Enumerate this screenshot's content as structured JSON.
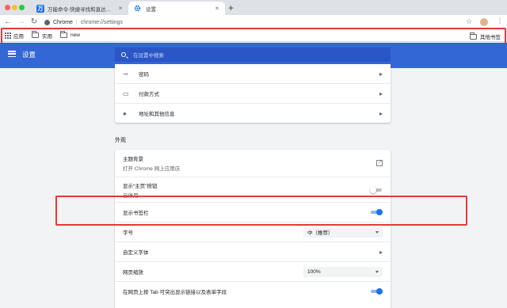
{
  "browser": {
    "tabs": [
      {
        "favicon_text": "万",
        "title": "万能命令-快捷寻找和直达你想要的...",
        "close": "×"
      },
      {
        "title": "设置",
        "close": "×"
      }
    ],
    "new_tab": "+",
    "omnibox": {
      "scheme_label": "Chrome",
      "separator": "|",
      "url": "chrome://settings"
    },
    "bookmarks": [
      {
        "label": "应用",
        "icon": "apps-grid-icon"
      },
      {
        "label": "实用",
        "icon": "folder-icon"
      },
      {
        "label": "new",
        "icon": "folder-icon"
      }
    ],
    "other_bookmarks": "其他书签"
  },
  "settings": {
    "header_title": "设置",
    "search_placeholder": "在设置中搜索",
    "autofill_rows": [
      {
        "label": "密码",
        "icon": "key-icon"
      },
      {
        "label": "付款方式",
        "icon": "credit-card-icon"
      },
      {
        "label": "地址和其他信息",
        "icon": "location-pin-icon"
      }
    ],
    "appearance_title": "外观",
    "appearance_rows": {
      "theme": {
        "label": "主题背景",
        "sub": "打开 Chrome 网上应用店"
      },
      "home_button": {
        "label": "显示“主页”按钮",
        "sub": "已停用",
        "enabled": false
      },
      "bookmarks_bar": {
        "label": "显示书签栏",
        "enabled": true
      },
      "font_size": {
        "label": "字号",
        "value": "中（推荐）"
      },
      "custom_fonts": {
        "label": "自定义字体"
      },
      "zoom": {
        "label": "网页缩放",
        "value": "100%"
      },
      "tab_highlight": {
        "label": "在网页上按 Tab 可突出显示链接以及表单字段",
        "enabled": true
      }
    }
  },
  "annotation_color": "#e53935",
  "accent_color": "#3367d6"
}
